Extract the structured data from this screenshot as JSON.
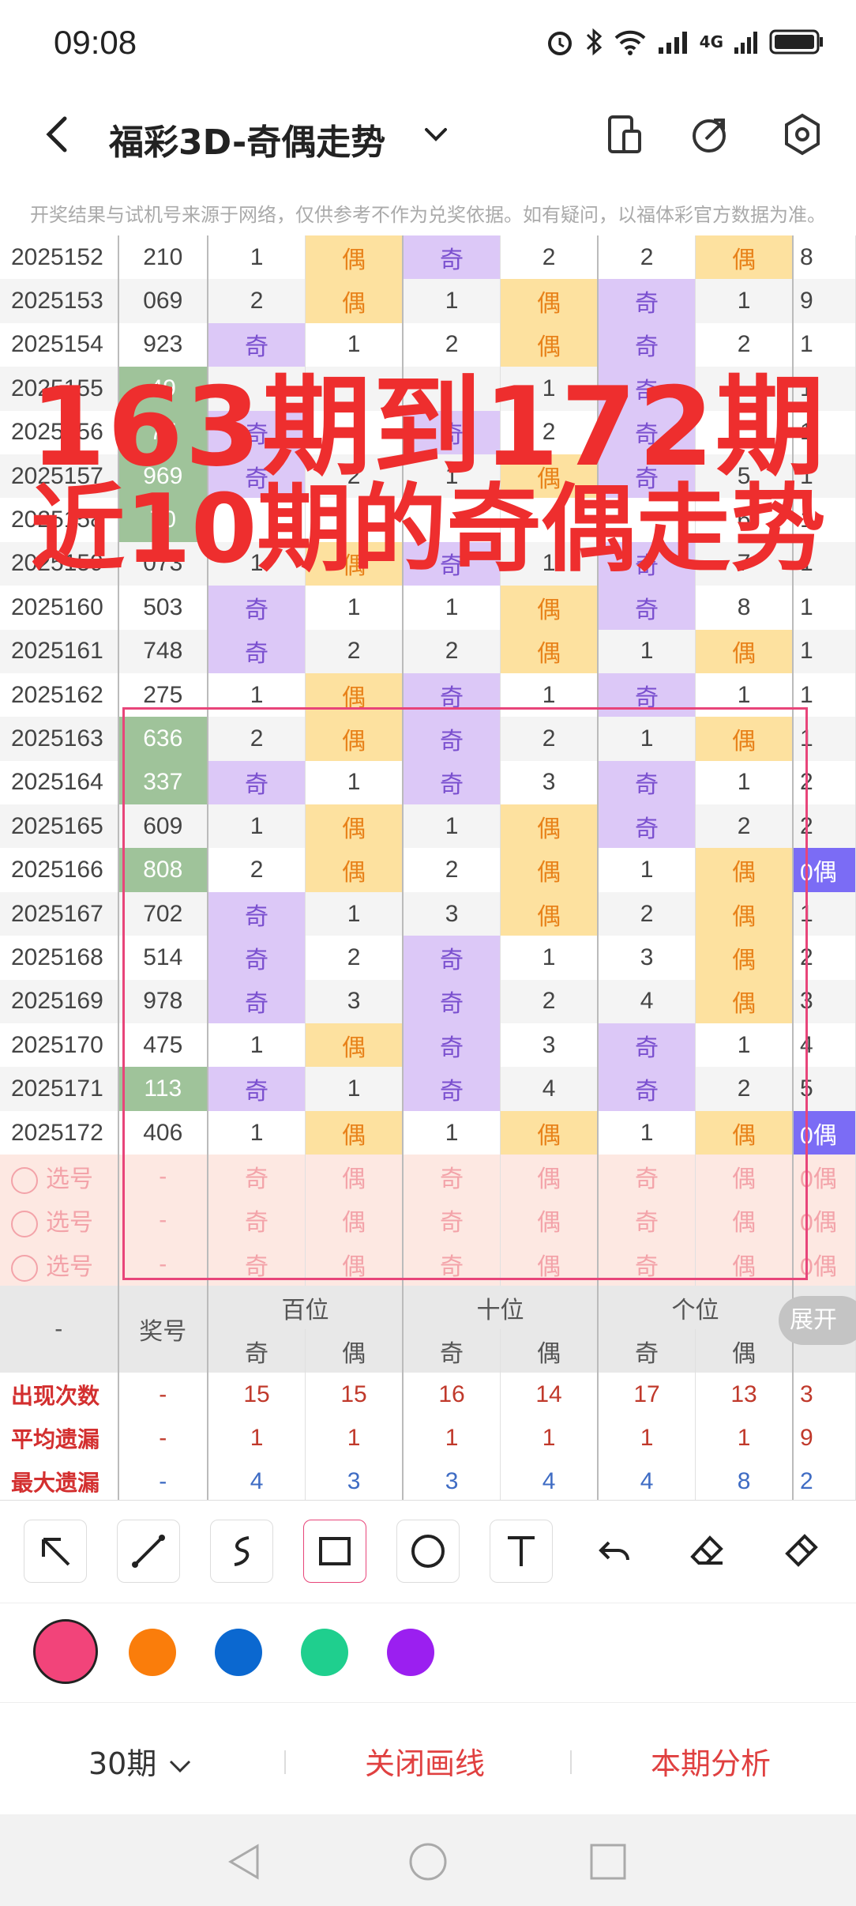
{
  "status": {
    "time": "09:08",
    "network": "4G"
  },
  "header": {
    "title": "福彩3D-奇偶走势"
  },
  "notice": "开奖结果与试机号来源于网络，仅供参考不作为兑奖依据。如有疑问，以福体彩官方数据为准。",
  "overlay": {
    "line1": "163期到172期",
    "line2": "近10期的奇偶走势"
  },
  "rows": [
    {
      "issue": "2025152",
      "num": "210",
      "h": [
        "1",
        "偶"
      ],
      "t": [
        "奇",
        "2"
      ],
      "u": [
        "2",
        "偶"
      ],
      "last": "8"
    },
    {
      "issue": "2025153",
      "num": "069",
      "h": [
        "2",
        "偶"
      ],
      "t": [
        "1",
        "偶"
      ],
      "u": [
        "奇",
        "1"
      ],
      "last": "9"
    },
    {
      "issue": "2025154",
      "num": "923",
      "h": [
        "奇",
        "1"
      ],
      "t": [
        "2",
        "偶"
      ],
      "u": [
        "奇",
        "2"
      ],
      "last": "1"
    },
    {
      "issue": "2025155",
      "num": "49",
      "h": [
        "",
        ""
      ],
      "t": [
        "",
        "1"
      ],
      "u": [
        "奇",
        ""
      ],
      "last": "1"
    },
    {
      "issue": "2025156",
      "num": "77",
      "h": [
        "奇",
        ""
      ],
      "t": [
        "奇",
        "2"
      ],
      "u": [
        "奇",
        ""
      ],
      "last": "1"
    },
    {
      "issue": "2025157",
      "num": "969",
      "h": [
        "奇",
        "2"
      ],
      "t": [
        "1",
        "偶"
      ],
      "u": [
        "奇",
        "5"
      ],
      "last": "1"
    },
    {
      "issue": "2025158",
      "num": "70",
      "h": [
        "",
        ""
      ],
      "t": [
        "",
        ""
      ],
      "u": [
        "",
        "6"
      ],
      "last": "1"
    },
    {
      "issue": "2025159",
      "num": "073",
      "h": [
        "1",
        "偶"
      ],
      "t": [
        "奇",
        "1"
      ],
      "u": [
        "奇",
        "7"
      ],
      "last": "1"
    },
    {
      "issue": "2025160",
      "num": "503",
      "h": [
        "奇",
        "1"
      ],
      "t": [
        "1",
        "偶"
      ],
      "u": [
        "奇",
        "8"
      ],
      "last": "1"
    },
    {
      "issue": "2025161",
      "num": "748",
      "h": [
        "奇",
        "2"
      ],
      "t": [
        "2",
        "偶"
      ],
      "u": [
        "1",
        "偶"
      ],
      "last": "1"
    },
    {
      "issue": "2025162",
      "num": "275",
      "h": [
        "1",
        "偶"
      ],
      "t": [
        "奇",
        "1"
      ],
      "u": [
        "奇",
        "1"
      ],
      "last": "1"
    },
    {
      "issue": "2025163",
      "num": "636",
      "h": [
        "2",
        "偶"
      ],
      "t": [
        "奇",
        "2"
      ],
      "u": [
        "1",
        "偶"
      ],
      "last": "1"
    },
    {
      "issue": "2025164",
      "num": "337",
      "h": [
        "奇",
        "1"
      ],
      "t": [
        "奇",
        "3"
      ],
      "u": [
        "奇",
        "1"
      ],
      "last": "2"
    },
    {
      "issue": "2025165",
      "num": "609",
      "h": [
        "1",
        "偶"
      ],
      "t": [
        "1",
        "偶"
      ],
      "u": [
        "奇",
        "2"
      ],
      "last": "2"
    },
    {
      "issue": "2025166",
      "num": "808",
      "h": [
        "2",
        "偶"
      ],
      "t": [
        "2",
        "偶"
      ],
      "u": [
        "1",
        "偶"
      ],
      "last": "0偶"
    },
    {
      "issue": "2025167",
      "num": "702",
      "h": [
        "奇",
        "1"
      ],
      "t": [
        "3",
        "偶"
      ],
      "u": [
        "2",
        "偶"
      ],
      "last": "1"
    },
    {
      "issue": "2025168",
      "num": "514",
      "h": [
        "奇",
        "2"
      ],
      "t": [
        "奇",
        "1"
      ],
      "u": [
        "3",
        "偶"
      ],
      "last": "2"
    },
    {
      "issue": "2025169",
      "num": "978",
      "h": [
        "奇",
        "3"
      ],
      "t": [
        "奇",
        "2"
      ],
      "u": [
        "4",
        "偶"
      ],
      "last": "3"
    },
    {
      "issue": "2025170",
      "num": "475",
      "h": [
        "1",
        "偶"
      ],
      "t": [
        "奇",
        "3"
      ],
      "u": [
        "奇",
        "1"
      ],
      "last": "4"
    },
    {
      "issue": "2025171",
      "num": "113",
      "h": [
        "奇",
        "1"
      ],
      "t": [
        "奇",
        "4"
      ],
      "u": [
        "奇",
        "2"
      ],
      "last": "5"
    },
    {
      "issue": "2025172",
      "num": "406",
      "h": [
        "1",
        "偶"
      ],
      "t": [
        "1",
        "偶"
      ],
      "u": [
        "1",
        "偶"
      ],
      "last": "0偶"
    }
  ],
  "select_rows": [
    {
      "label": "选号",
      "num": "-",
      "vals": [
        "奇",
        "偶",
        "奇",
        "偶",
        "奇",
        "偶"
      ],
      "last": "0偶"
    },
    {
      "label": "选号",
      "num": "-",
      "vals": [
        "奇",
        "偶",
        "奇",
        "偶",
        "奇",
        "偶"
      ],
      "last": "0偶"
    },
    {
      "label": "选号",
      "num": "-",
      "vals": [
        "奇",
        "偶",
        "奇",
        "偶",
        "奇",
        "偶"
      ],
      "last": "0偶"
    }
  ],
  "footer": {
    "dash": "-",
    "prize_label": "奖号",
    "groups": [
      "百位",
      "十位",
      "个位"
    ],
    "sub": [
      "奇",
      "偶",
      "奇",
      "偶",
      "奇",
      "偶"
    ],
    "stats": [
      {
        "label": "出现次数",
        "num": "-",
        "vals": [
          "15",
          "15",
          "16",
          "14",
          "17",
          "13"
        ],
        "last": "3"
      },
      {
        "label": "平均遗漏",
        "num": "-",
        "vals": [
          "1",
          "1",
          "1",
          "1",
          "1",
          "1"
        ],
        "last": "9"
      },
      {
        "label": "最大遗漏",
        "num": "-",
        "vals": [
          "4",
          "3",
          "3",
          "4",
          "4",
          "8"
        ],
        "last": "2"
      }
    ]
  },
  "expand_label": "展开",
  "toolbar": {
    "tools": [
      "arrow-tool-icon",
      "line-tool-icon",
      "freehand-tool-icon",
      "rectangle-tool-icon",
      "circle-tool-icon",
      "text-tool-icon",
      "undo-icon",
      "eraser-icon",
      "clear-brush-icon"
    ],
    "colors": [
      "#f2447a",
      "#fa7d0b",
      "#0b68d0",
      "#1fcf8e",
      "#9b1ff0"
    ]
  },
  "bottom": {
    "period": "30期",
    "close_draw": "关闭画线",
    "analysis": "本期分析"
  }
}
